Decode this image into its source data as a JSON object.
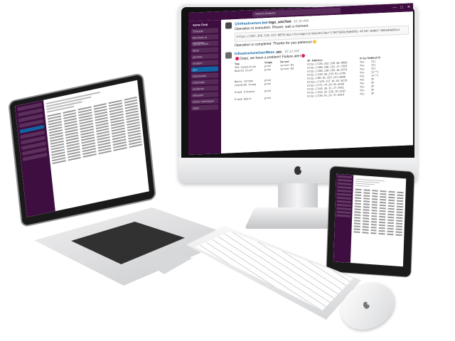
{
  "imac": {
    "search_placeholder": "Search Antacrm",
    "window_controls": [
      "—",
      "□",
      "✕"
    ],
    "sidebar": {
      "workspace": "Acme Corp",
      "items": [
        "Threads",
        "Mentions & reactions",
        "Saved items",
        "More",
        "general",
        "random",
        "ops",
        "Directories",
        "Channels",
        "incidents",
        "releases",
        "Direct messages",
        "Apps"
      ]
    },
    "messages": [
      {
        "author": "@infrastructure.bot",
        "action": "logs_w4r7twt",
        "time": "10:10 AM",
        "text": "Operation in execution. Please, wait a moment.",
        "code": "https://207.256.124.127:8875/api/storage/v1/dataFolder?/1877639c5b84f8c-4ffd7-b0bb7-965a4de0Scd"
      },
      {
        "author": "",
        "action": "",
        "time": "",
        "text": "Operation is completed. Thanks for you patience!",
        "code": ""
      },
      {
        "author": "InfrastructureUserMess",
        "action": "APP",
        "time": "10:12 AM",
        "text": "Oops, we have a problem! Failure alert",
        "code": ""
      }
    ],
    "table": {
      "headers": [
        "Tag",
        "Stage",
        "Server",
        "IP Address",
        "Prim/Sec",
        "Health"
      ],
      "rows": [
        [
          "The Connection",
          "prod",
          "server-01",
          "http://126.162.150.46:9050",
          "Yes",
          "[k]"
        ],
        [
          "Health Gluff",
          "prod",
          "server-02",
          "http://186.186.122.17:7555",
          "Yes",
          "[k]"
        ],
        [
          "",
          "",
          "",
          "http://186.130.145.16:4774",
          "Yes",
          "[k]"
        ],
        [
          "",
          "",
          "",
          "http://130.58.235.91:2799",
          "Yes",
          "[k**]"
        ],
        [
          "Nancy Jordan",
          "prod",
          "",
          "http://80.61.253.157:6046",
          "Yes",
          "[k**]"
        ],
        [
          "Leonardo Group",
          "prod",
          "",
          "https://129.117.81.61:8119",
          "Yes",
          "SP"
        ],
        [
          "",
          "",
          "",
          "http://171.74.24.55:4558",
          "Yes",
          "SP"
        ],
        [
          "Great Finance",
          "prod",
          "",
          "http://145.36.31.27:7951",
          "Yes",
          "SP"
        ],
        [
          "",
          "",
          "",
          "http://154.53.226.79:2167",
          "Yes",
          "SP"
        ],
        [
          "Frank Heart",
          "prod",
          "",
          "http://230.91.24.37:3019",
          "Yes",
          "SP"
        ]
      ]
    }
  },
  "laptop": {
    "sidebar_items": 10,
    "rows": 18
  },
  "ipad": {
    "sidebar_items": 12,
    "rows": 16
  },
  "colors": {
    "slack_purple": "#3f0e40",
    "active_blue": "#1164a3",
    "link_blue": "#1264a3",
    "aluminum": "#d9dadc",
    "bezel": "#111111"
  }
}
